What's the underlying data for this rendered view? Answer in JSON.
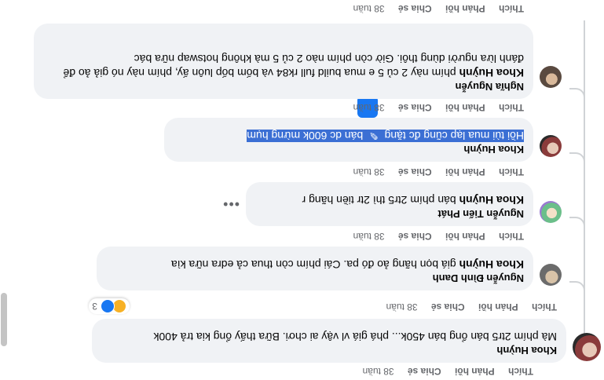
{
  "comment_main": {
    "author": "Khoa Huỳnh",
    "text": "Mà phím 2tr5 bán ổng bán 450k... phá giá vl vậy ai chơi. Bữa thấy ổng kia trả 400k",
    "actions": {
      "like": "Thích",
      "reply": "Phản hồi",
      "share": "Chia sẻ",
      "time": "38 tuần"
    },
    "reaction_count": "3"
  },
  "replies": [
    {
      "author": "Nguyễn Đình Danh",
      "mention": "Khoa Huỳnh",
      "text": " giá bọn hãng ảo đó pa. Cái phím còn thua cả edra nữa kìa",
      "actions": {
        "like": "Thích",
        "reply": "Phản hồi",
        "share": "Chia sẻ",
        "time": "38 tuần"
      }
    },
    {
      "author": "Nguyễn Tiến Phát",
      "mention": "Khoa Huỳnh",
      "text": " bán phím 2tr5 thì 2tr tiền hãng r",
      "actions": {
        "like": "Thích",
        "reply": "Phản hồi",
        "share": "Chia sẻ",
        "time": "38 tuần"
      }
    },
    {
      "author": "Khoa Huỳnh",
      "text_a": "Hồi tùi mua lạp cũng đc tặng ",
      "text_b": " bán dc 600k mừng hụm",
      "actions": {
        "like": "Thích",
        "reply": "Phản hồi",
        "share": "Chia sẻ",
        "time": "38 tuần"
      }
    },
    {
      "author": "Nghĩa Nguyễn",
      "mention": "Khoa Huỳnh",
      "text": " phím này 2 củ 5 e mua build full rk84 và bốm bốp luôn ấy, phím này nó giả ảo để đánh lừa người dùng thôi. Giờ còn phím nào 2 củ 5 mà không hotswap nữa bác",
      "actions": {
        "like": "Thích",
        "reply": "Phản hồi",
        "share": "Chia sẻ",
        "time": "38 tuần"
      }
    }
  ],
  "top_actions": {
    "like": "Thích",
    "reply": "Phản hồi",
    "share": "Chia sẻ",
    "time": "38 tuần"
  },
  "colors": {
    "bubble": "#f0f2f5",
    "highlight": "#3b6fd4",
    "muted": "#65676b",
    "accent": "#1877f2"
  },
  "icons": [
    "more-horizontal-icon",
    "copy-icon",
    "haha-reaction-icon",
    "like-reaction-icon"
  ]
}
